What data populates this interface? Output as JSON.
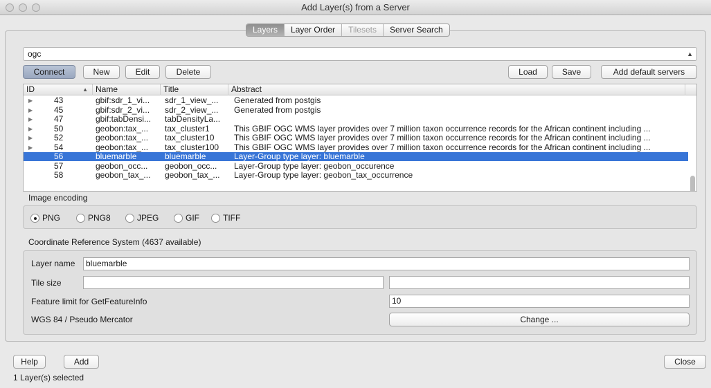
{
  "window": {
    "title": "Add Layer(s) from a Server"
  },
  "tabs": [
    {
      "label": "Layers",
      "state": "active"
    },
    {
      "label": "Layer Order",
      "state": "normal"
    },
    {
      "label": "Tilesets",
      "state": "disabled"
    },
    {
      "label": "Server Search",
      "state": "normal"
    }
  ],
  "connection": {
    "selected": "ogc"
  },
  "toolbar": {
    "connect": "Connect",
    "new": "New",
    "edit": "Edit",
    "delete": "Delete",
    "load": "Load",
    "save": "Save",
    "add_default": "Add default servers"
  },
  "table": {
    "columns": [
      "ID",
      "Name",
      "Title",
      "Abstract"
    ],
    "rows": [
      {
        "id": "43",
        "name": "gbif:sdr_1_vi...",
        "title": "sdr_1_view_...",
        "abstract": "Generated from postgis",
        "expandable": true,
        "selected": false
      },
      {
        "id": "45",
        "name": "gbif:sdr_2_vi...",
        "title": "sdr_2_view_...",
        "abstract": "Generated from postgis",
        "expandable": true,
        "selected": false
      },
      {
        "id": "47",
        "name": "gbif:tabDensi...",
        "title": "tabDensityLa...",
        "abstract": "",
        "expandable": true,
        "selected": false
      },
      {
        "id": "50",
        "name": "geobon:tax_...",
        "title": "tax_cluster1",
        "abstract": "This GBIF OGC WMS layer provides over 7 million taxon occurrence records for the African continent including ...",
        "expandable": true,
        "selected": false
      },
      {
        "id": "52",
        "name": "geobon:tax_...",
        "title": "tax_cluster10",
        "abstract": "This GBIF OGC WMS layer provides over 7 million taxon occurrence records for the African continent including ...",
        "expandable": true,
        "selected": false
      },
      {
        "id": "54",
        "name": "geobon:tax_...",
        "title": "tax_cluster100",
        "abstract": "This GBIF OGC WMS layer provides over 7 million taxon occurrence records for the African continent including ...",
        "expandable": true,
        "selected": false
      },
      {
        "id": "56",
        "name": "bluemarble",
        "title": "bluemarble",
        "abstract": "Layer-Group type layer: bluemarble",
        "expandable": false,
        "selected": true
      },
      {
        "id": "57",
        "name": "geobon_occ...",
        "title": "geobon_occ...",
        "abstract": "Layer-Group type layer: geobon_occurence",
        "expandable": false,
        "selected": false
      },
      {
        "id": "58",
        "name": "geobon_tax_...",
        "title": "geobon_tax_...",
        "abstract": "Layer-Group type layer: geobon_tax_occurrence",
        "expandable": false,
        "selected": false
      }
    ]
  },
  "image_encoding": {
    "label": "Image encoding",
    "options": [
      "PNG",
      "PNG8",
      "JPEG",
      "GIF",
      "TIFF"
    ],
    "selected": "PNG"
  },
  "crs": {
    "label": "Coordinate Reference System (4637 available)",
    "current": "WGS 84 / Pseudo Mercator",
    "change_button": "Change ..."
  },
  "form": {
    "layer_name_label": "Layer name",
    "layer_name_value": "bluemarble",
    "tile_size_label": "Tile size",
    "tile_width_value": "",
    "tile_height_value": "",
    "feature_limit_label": "Feature limit for GetFeatureInfo",
    "feature_limit_value": "10"
  },
  "footer": {
    "help": "Help",
    "add": "Add",
    "close": "Close",
    "status": "1 Layer(s) selected"
  },
  "colors": {
    "selection": "#3875d7"
  }
}
